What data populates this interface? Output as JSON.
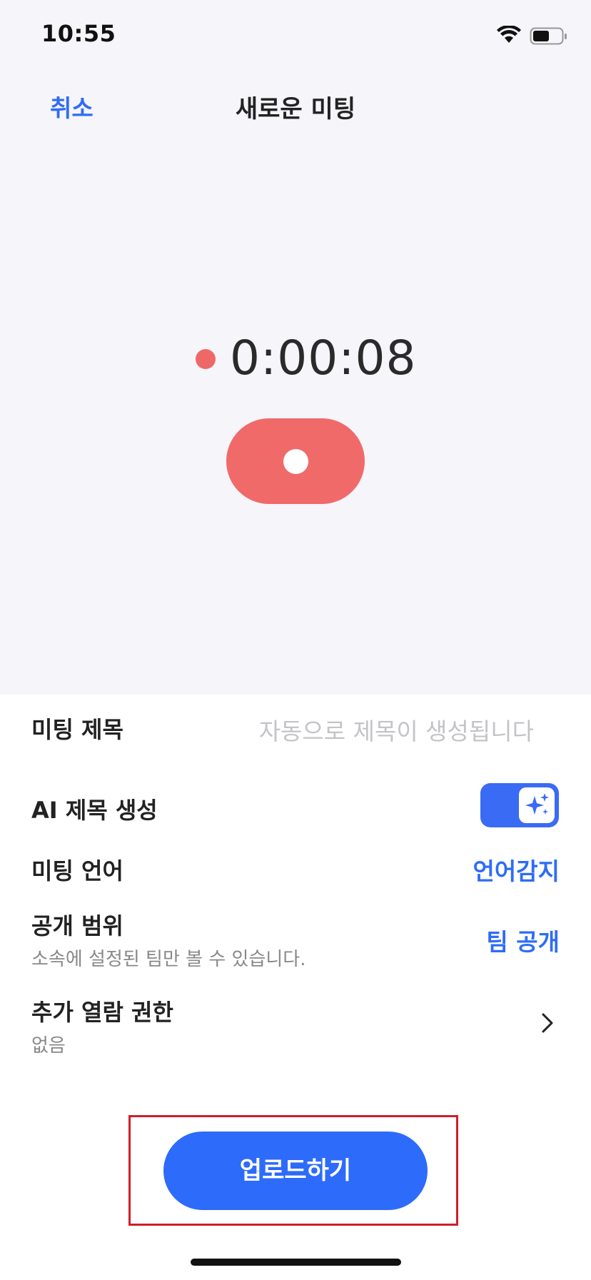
{
  "status_bar": {
    "time": "10:55"
  },
  "nav": {
    "cancel": "취소",
    "title": "새로운 미팅"
  },
  "recorder": {
    "elapsed": "0:00:08"
  },
  "settings": {
    "title_row": {
      "label": "미팅 제목",
      "placeholder": "자동으로 제목이 생성됩니다"
    },
    "ai_title_row": {
      "label": "AI 제목 생성",
      "enabled": true
    },
    "language_row": {
      "label": "미팅 언어",
      "value": "언어감지"
    },
    "visibility_row": {
      "label": "공개 범위",
      "description": "소속에 설정된 팀만 볼 수 있습니다.",
      "value": "팀 공개"
    },
    "extra_access_row": {
      "label": "추가 열람 권한",
      "value": "없음"
    }
  },
  "upload": {
    "label": "업로드하기"
  },
  "colors": {
    "accent": "#2f6cf6",
    "record": "#f06a6a",
    "highlight": "#d01e2a"
  }
}
